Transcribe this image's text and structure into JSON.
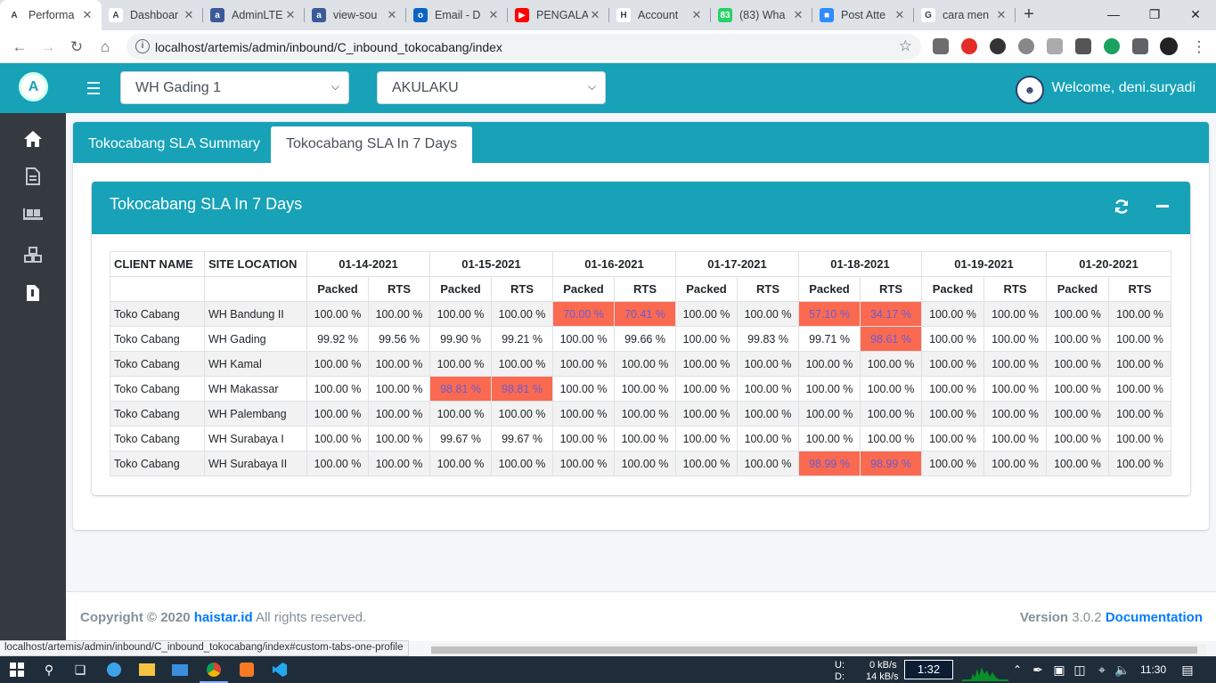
{
  "browser": {
    "tabs": [
      {
        "title": "Performa",
        "color": "#ffffff",
        "glyph": "A",
        "active": true
      },
      {
        "title": "Dashboar",
        "color": "#ffffff",
        "glyph": "A"
      },
      {
        "title": "AdminLTE",
        "color": "#3c5a99",
        "glyph": "a"
      },
      {
        "title": "view-sou",
        "color": "#3c5a99",
        "glyph": "a"
      },
      {
        "title": "Email - D",
        "color": "#0a64c8",
        "glyph": "o"
      },
      {
        "title": "PENGALA",
        "color": "#ff0000",
        "glyph": "▶"
      },
      {
        "title": "Account",
        "color": "#ffffff",
        "glyph": "H"
      },
      {
        "title": "(83) Wha",
        "color": "#25d366",
        "glyph": "83"
      },
      {
        "title": "Post Atte",
        "color": "#2d8cff",
        "glyph": "■"
      },
      {
        "title": "cara men",
        "color": "#ffffff",
        "glyph": "G"
      }
    ],
    "url": "localhost/artemis/admin/inbound/C_inbound_tokocabang/index",
    "status_url": "localhost/artemis/admin/inbound/C_inbound_tokocabang/index#custom-tabs-one-profile"
  },
  "topnav": {
    "warehouse_select": "WH Gading 1",
    "client_select": "AKULAKU",
    "welcome": "Welcome, deni.suryadi"
  },
  "tabs": {
    "summary": "Tokocabang SLA Summary",
    "seven_days": "Tokocabang SLA In 7 Days"
  },
  "card": {
    "title": "Tokocabang SLA In 7 Days"
  },
  "table": {
    "col_client": "CLIENT NAME",
    "col_site": "SITE LOCATION",
    "dates": [
      "01-14-2021",
      "01-15-2021",
      "01-16-2021",
      "01-17-2021",
      "01-18-2021",
      "01-19-2021",
      "01-20-2021"
    ],
    "sub_packed": "Packed",
    "sub_rts": "RTS",
    "rows": [
      {
        "client": "Toko Cabang",
        "site": "WH Bandung II",
        "values": [
          "100.00 %",
          "100.00 %",
          "100.00 %",
          "100.00 %",
          "70.00 %",
          "70.41 %",
          "100.00 %",
          "100.00 %",
          "57.10 %",
          "34.17 %",
          "100.00 %",
          "100.00 %",
          "100.00 %",
          "100.00 %"
        ],
        "bad": [
          4,
          5,
          8,
          9
        ]
      },
      {
        "client": "Toko Cabang",
        "site": "WH Gading",
        "values": [
          "99.92 %",
          "99.56 %",
          "99.90 %",
          "99.21 %",
          "100.00 %",
          "99.66 %",
          "100.00 %",
          "99.83 %",
          "99.71 %",
          "98.61 %",
          "100.00 %",
          "100.00 %",
          "100.00 %",
          "100.00 %"
        ],
        "bad": [
          9
        ]
      },
      {
        "client": "Toko Cabang",
        "site": "WH Kamal",
        "values": [
          "100.00 %",
          "100.00 %",
          "100.00 %",
          "100.00 %",
          "100.00 %",
          "100.00 %",
          "100.00 %",
          "100.00 %",
          "100.00 %",
          "100.00 %",
          "100.00 %",
          "100.00 %",
          "100.00 %",
          "100.00 %"
        ],
        "bad": []
      },
      {
        "client": "Toko Cabang",
        "site": "WH Makassar",
        "values": [
          "100.00 %",
          "100.00 %",
          "98.81 %",
          "98.81 %",
          "100.00 %",
          "100.00 %",
          "100.00 %",
          "100.00 %",
          "100.00 %",
          "100.00 %",
          "100.00 %",
          "100.00 %",
          "100.00 %",
          "100.00 %"
        ],
        "bad": [
          2,
          3
        ]
      },
      {
        "client": "Toko Cabang",
        "site": "WH Palembang",
        "values": [
          "100.00 %",
          "100.00 %",
          "100.00 %",
          "100.00 %",
          "100.00 %",
          "100.00 %",
          "100.00 %",
          "100.00 %",
          "100.00 %",
          "100.00 %",
          "100.00 %",
          "100.00 %",
          "100.00 %",
          "100.00 %"
        ],
        "bad": []
      },
      {
        "client": "Toko Cabang",
        "site": "WH Surabaya I",
        "values": [
          "100.00 %",
          "100.00 %",
          "99.67 %",
          "99.67 %",
          "100.00 %",
          "100.00 %",
          "100.00 %",
          "100.00 %",
          "100.00 %",
          "100.00 %",
          "100.00 %",
          "100.00 %",
          "100.00 %",
          "100.00 %"
        ],
        "bad": []
      },
      {
        "client": "Toko Cabang",
        "site": "WH Surabaya II",
        "values": [
          "100.00 %",
          "100.00 %",
          "100.00 %",
          "100.00 %",
          "100.00 %",
          "100.00 %",
          "100.00 %",
          "100.00 %",
          "98.99 %",
          "98.99 %",
          "100.00 %",
          "100.00 %",
          "100.00 %",
          "100.00 %"
        ],
        "bad": [
          8,
          9
        ]
      }
    ]
  },
  "footer": {
    "copyright": "Copyright © 2020",
    "brand": "haistar.id",
    "rights": "All rights reserved.",
    "version_label": "Version",
    "version": "3.0.2",
    "docs": "Documentation"
  },
  "taskbar": {
    "upload_label": "U:",
    "download_label": "D:",
    "upload_rate": "0 kB/s",
    "download_rate": "14 kB/s",
    "timer": "1:32",
    "clock": "11:30"
  },
  "colors": {
    "primary": "#17a2b8",
    "sidebar": "#343a40",
    "bad_cell": "#fa6a50",
    "bad_text": "#6a5bd6",
    "link": "#007bff"
  }
}
